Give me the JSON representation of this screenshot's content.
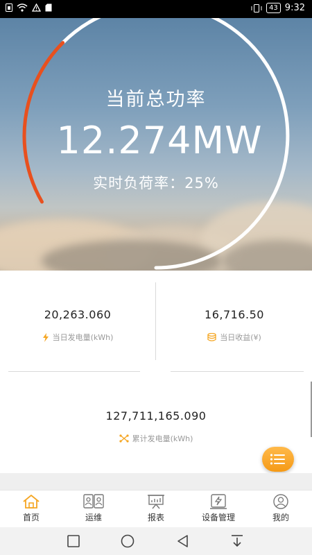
{
  "status_bar": {
    "time": "9:32",
    "battery": "43"
  },
  "hero": {
    "title": "当前总功率",
    "power": "12.274MW",
    "load_rate": "实时负荷率：25%",
    "load_fraction": 0.25
  },
  "stats": {
    "daily_generation": {
      "value": "20,263.060",
      "label": "当日发电量(kWh)"
    },
    "daily_income": {
      "value": "16,716.50",
      "label": "当日收益(¥)"
    },
    "total_generation": {
      "value": "127,711,165.090",
      "label": "累计发电量(kWh)"
    }
  },
  "tabs": [
    {
      "label": "首页",
      "icon": "home-icon"
    },
    {
      "label": "运维",
      "icon": "maintenance-icon"
    },
    {
      "label": "报表",
      "icon": "report-icon"
    },
    {
      "label": "设备管理",
      "icon": "device-icon"
    },
    {
      "label": "我的",
      "icon": "user-icon"
    }
  ],
  "colors": {
    "accent": "#f5a623",
    "gauge_active": "#e8501e",
    "gauge_track": "#ffffff"
  },
  "system_nav": {
    "icons": [
      "square-icon",
      "circle-icon",
      "back-icon",
      "menu-down-icon"
    ]
  }
}
